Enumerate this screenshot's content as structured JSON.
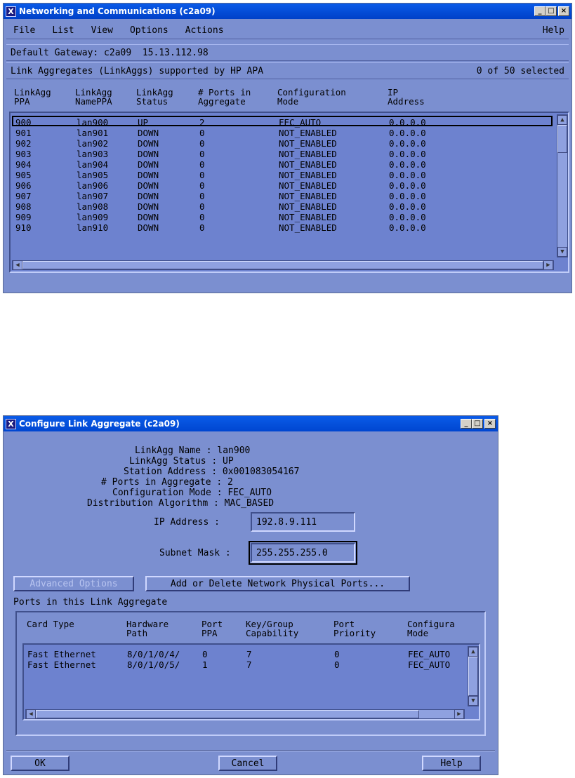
{
  "net_window": {
    "title": "Networking and Communications (c2a09)",
    "title_icon": "X",
    "win_buttons": {
      "minimize": "_",
      "maximize": "□",
      "close": "×"
    },
    "menus": [
      {
        "label": "File"
      },
      {
        "label": "List"
      },
      {
        "label": "View"
      },
      {
        "label": "Options"
      },
      {
        "label": "Actions"
      }
    ],
    "help_menu": "Help",
    "gateway": "Default Gateway: c2a09  15.13.112.98",
    "list_title": "Link Aggregates (LinkAggs) supported by HP APA",
    "selection_count": "0 of 50 selected",
    "columns": [
      "LinkAgg\nPPA",
      "LinkAgg\nNamePPA",
      "LinkAgg\nStatus",
      "# Ports in\nAggregate",
      "Configuration\nMode",
      "IP\nAddress"
    ],
    "rows": [
      [
        "900",
        "lan900",
        "UP",
        "2",
        "FEC_AUTO",
        "0.0.0.0"
      ],
      [
        "901",
        "lan901",
        "DOWN",
        "0",
        "NOT_ENABLED",
        "0.0.0.0"
      ],
      [
        "902",
        "lan902",
        "DOWN",
        "0",
        "NOT_ENABLED",
        "0.0.0.0"
      ],
      [
        "903",
        "lan903",
        "DOWN",
        "0",
        "NOT_ENABLED",
        "0.0.0.0"
      ],
      [
        "904",
        "lan904",
        "DOWN",
        "0",
        "NOT_ENABLED",
        "0.0.0.0"
      ],
      [
        "905",
        "lan905",
        "DOWN",
        "0",
        "NOT_ENABLED",
        "0.0.0.0"
      ],
      [
        "906",
        "lan906",
        "DOWN",
        "0",
        "NOT_ENABLED",
        "0.0.0.0"
      ],
      [
        "907",
        "lan907",
        "DOWN",
        "0",
        "NOT_ENABLED",
        "0.0.0.0"
      ],
      [
        "908",
        "lan908",
        "DOWN",
        "0",
        "NOT_ENABLED",
        "0.0.0.0"
      ],
      [
        "909",
        "lan909",
        "DOWN",
        "0",
        "NOT_ENABLED",
        "0.0.0.0"
      ],
      [
        "910",
        "lan910",
        "DOWN",
        "0",
        "NOT_ENABLED",
        "0.0.0.0"
      ]
    ]
  },
  "cfg_window": {
    "title": "Configure Link Aggregate (c2a09)",
    "title_icon": "X",
    "win_buttons": {
      "minimize": "_",
      "maximize": "□",
      "close": "×"
    },
    "info": [
      "LinkAgg Name : lan900",
      "LinkAgg Status : UP",
      "Station Address : 0x001083054167",
      "# Ports in Aggregate : 2",
      "Configuration Mode : FEC_AUTO",
      "Distribution Algorithm : MAC_BASED"
    ],
    "ip_label": "IP Address :",
    "ip_value": "192.8.9.111",
    "subnet_label": "Subnet Mask :",
    "subnet_value": "255.255.255.0",
    "advanced_button": "Advanced Options",
    "add_delete_button": "Add or Delete Network Physical Ports...",
    "ports_label": "Ports in this Link Aggregate",
    "port_columns": [
      "Card Type",
      "Hardware\nPath",
      "Port\nPPA",
      "Key/Group\nCapability",
      "Port\nPriority",
      "Configura\nMode"
    ],
    "port_rows": [
      [
        "Fast Ethernet",
        "8/0/1/0/4/",
        "0",
        "7",
        "0",
        "FEC_AUTO"
      ],
      [
        "Fast Ethernet",
        "8/0/1/0/5/",
        "1",
        "7",
        "0",
        "FEC_AUTO"
      ]
    ],
    "ok_button": "OK",
    "cancel_button": "Cancel",
    "help_button": "Help"
  },
  "colors": {
    "window_bg": "#7b8fd0",
    "list_bg": "#6d82cf",
    "title_active": "#0a5be8"
  }
}
